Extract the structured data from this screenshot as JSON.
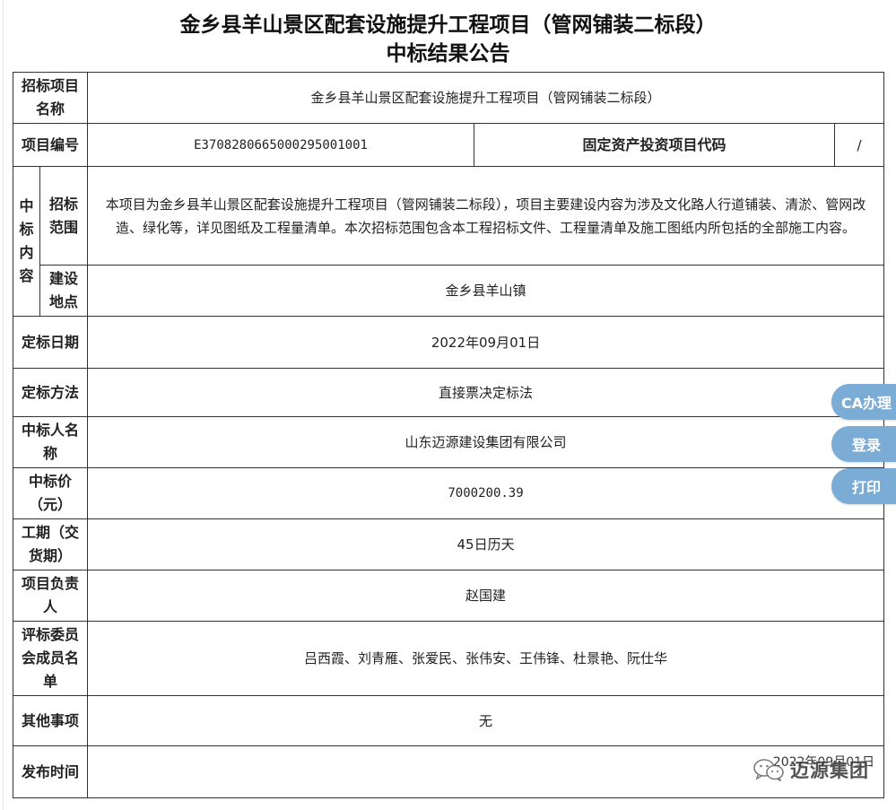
{
  "header": {
    "title_line1": "金乡县羊山景区配套设施提升工程项目（管网铺装二标段）",
    "title_line2": "中标结果公告"
  },
  "table": {
    "project_name_label": "招标项目名称",
    "project_name": "金乡县羊山景区配套设施提升工程项目（管网铺装二标段）",
    "project_no_label": "项目编号",
    "project_no": "E3708280665000295001001",
    "fixed_asset_label": "固定资产投资项目代码",
    "fixed_asset_code": "/",
    "content_label": "中标内容",
    "scope_label": "招标范围",
    "scope_text": "本项目为金乡县羊山景区配套设施提升工程项目（管网铺装二标段），项目主要建设内容为涉及文化路人行道铺装、清淤、管网改造、绿化等，详见图纸及工程量清单。本次招标范围包含本工程招标文件、工程量清单及施工图纸内所包括的全部施工内容。",
    "location_label": "建设地点",
    "location": "金乡县羊山镇",
    "award_date_label": "定标日期",
    "award_date": "2022年09月01日",
    "award_method_label": "定标方法",
    "award_method": "直接票决定标法",
    "winner_label": "中标人名称",
    "winner": "山东迈源建设集团有限公司",
    "price_label": "中标价（元）",
    "price": "7000200.39",
    "period_label": "工期（交货期）",
    "period": "45日历天",
    "manager_label": "项目负责人",
    "manager": "赵国建",
    "committee_label": "评标委员会成员名单",
    "committee": "吕西霞、刘青雁、张爱民、张伟安、王伟锋、杜景艳、阮仕华",
    "other_label": "其他事项",
    "other": "无",
    "publish_label": "发布时间",
    "publish_date": "2022年09月01日"
  },
  "side_buttons": {
    "ca": "CA办理",
    "login": "登录",
    "print": "打印"
  },
  "watermark": {
    "text": "迈源集团",
    "icon": "wechat-icon"
  },
  "colors": {
    "side_button_bg": "#7aacd6",
    "border": "#333333"
  }
}
